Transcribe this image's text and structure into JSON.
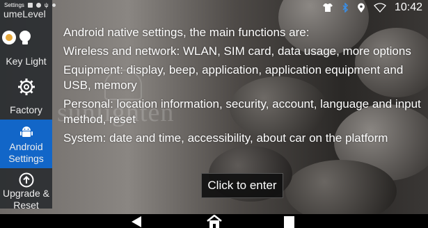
{
  "status_bar": {
    "app_label": "Settings",
    "time": "10:42"
  },
  "sidebar": {
    "cut_label": "umeLevel",
    "items": [
      {
        "label": "Key Light",
        "icon": "bulb-icon"
      },
      {
        "label": "Factory",
        "icon": "gear-icon"
      },
      {
        "label": "Android Settings",
        "icon": "android-icon",
        "active": true
      },
      {
        "label": "Upgrade & Reset",
        "icon": "upgrade-arrow-icon"
      }
    ],
    "accent_color": "#1266c8"
  },
  "background": {
    "watermark": "sunlighten"
  },
  "content": {
    "lines": [
      "Android native settings, the main functions are:",
      "Wireless and network: WLAN, SIM card, data usage, more options",
      "Equipment: display, beep, application, application equipment and USB, memory",
      "Personal: location information, security, account, language and input method, reset",
      "System: date and time, accessibility, about car on the platform"
    ]
  },
  "enter_button": {
    "label": "Click to enter"
  },
  "nav_bar": {
    "back_icon": "back-triangle-icon",
    "home_icon": "home-icon",
    "recents_icon": "recents-square-icon"
  }
}
